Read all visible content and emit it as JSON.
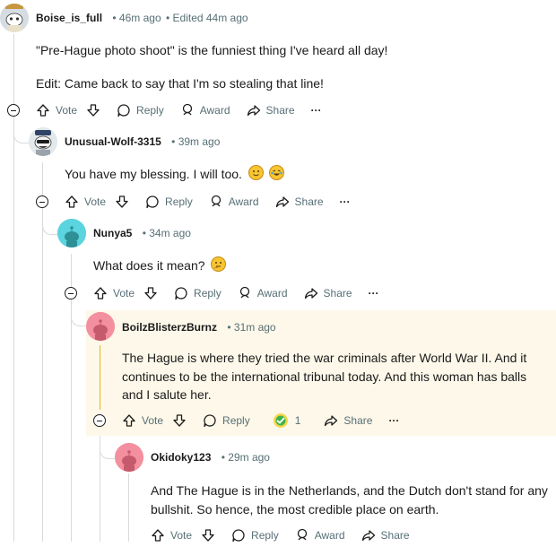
{
  "comments": [
    {
      "username": "Boise_is_full",
      "time": "46m ago",
      "edited": "Edited 44m ago",
      "paragraphs": [
        "\"Pre-Hague photo shoot\" is the funniest thing I've heard all day!",
        "Edit: Came back to say that I'm so stealing that line!"
      ],
      "actions": {
        "vote": "Vote",
        "reply": "Reply",
        "award": "Award",
        "share": "Share",
        "more": "···"
      }
    },
    {
      "username": "Unusual-Wolf-3315",
      "time": "39m ago",
      "paragraphs": [
        "You have my blessing. I will too."
      ],
      "emojis": [
        "smiling-face-icon",
        "tears-of-joy-icon"
      ],
      "actions": {
        "vote": "Vote",
        "reply": "Reply",
        "award": "Award",
        "share": "Share",
        "more": "···"
      }
    },
    {
      "username": "Nunya5",
      "time": "34m ago",
      "paragraphs": [
        "What does it mean?"
      ],
      "emojis": [
        "thinking-face-icon"
      ],
      "actions": {
        "vote": "Vote",
        "reply": "Reply",
        "award": "Award",
        "share": "Share",
        "more": "···"
      }
    },
    {
      "username": "BoilzBlisterzBurnz",
      "time": "31m ago",
      "paragraphs": [
        "The Hague is where they tried the war criminals after World War II. And it continues to be the international tribunal today. And this woman has balls and I salute her."
      ],
      "actions": {
        "vote": "Vote",
        "reply": "Reply",
        "award_count": "1",
        "share": "Share",
        "more": "···"
      }
    },
    {
      "username": "Okidoky123",
      "time": "29m ago",
      "paragraphs": [
        "And The Hague is in the Netherlands, and the Dutch don't stand for any bullshit. So hence, the most credible place on earth."
      ],
      "actions": {
        "vote": "Vote",
        "reply": "Reply",
        "award": "Award",
        "share": "Share"
      }
    }
  ],
  "separator": "•",
  "colors": {
    "text": "#1a1a1b",
    "meta": "#576f76",
    "thread_line": "#d7dadc",
    "highlight_bg": "#fdf8e9",
    "highlight_line": "#e8b416",
    "avatar_cyan": "#5ad4de",
    "avatar_pink": "#f48fa0",
    "avatar_navy": "#2e4366"
  }
}
